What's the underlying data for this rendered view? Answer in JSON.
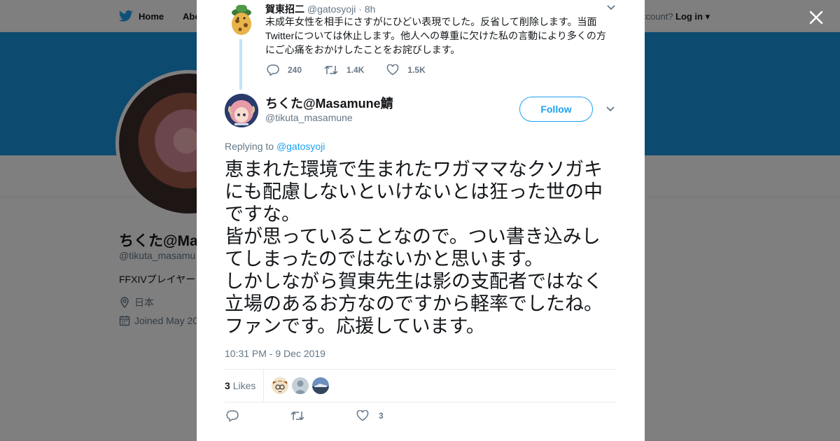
{
  "nav": {
    "home_label": "Home",
    "about_label": "Abo",
    "account_text": "ccount?",
    "login_label": "Log in"
  },
  "profile_bg": {
    "name": "ちくた@Ma",
    "handle": "@tikuta_masamu",
    "bio": "FFXIVプレイヤー",
    "location": "日本",
    "joined": "Joined May 20"
  },
  "parent_tweet": {
    "name": "賀東招二",
    "handle": "@gatosyoji",
    "dot": "·",
    "time": "8h",
    "text": "未成年女性を相手にさすがにひどい表現でした。反省して削除します。当面Twitterについては休止します。他人への尊重に欠けた私の言動により多くの方にご心痛をおかけしたことをお詫びします。",
    "replies": "240",
    "retweets": "1.4K",
    "likes": "1.5K"
  },
  "tweet": {
    "name": "ちくた@Masamune鯖",
    "handle": "@tikuta_masamune",
    "follow_label": "Follow",
    "replying_prefix": "Replying to",
    "replying_handle": "@gatosyoji",
    "text": "恵まれた環境で生まれたワガママなクソガキにも配慮しないといけないとは狂った世の中ですな。\n皆が思っていることなので。つい書き込みしてしまったのではないかと思います。\nしかしながら賀東先生は影の支配者ではなく立場のあるお方なのですから軽率でしたね。\nファンです。応援しています。",
    "timestamp": "10:31 PM - 9 Dec 2019",
    "likes_count": "3",
    "likes_label": "Likes",
    "action_like_count": "3"
  },
  "colors": {
    "brand": "#1da1f2",
    "banner": "#1b95e0",
    "thread_line": "#c4e4f7",
    "muted_text": "#657786"
  },
  "icons": {
    "logo": "twitter-bird-icon",
    "close": "close-icon",
    "reply": "reply-icon",
    "retweet": "retweet-icon",
    "like": "heart-icon",
    "menu": "chevron-down-icon",
    "location": "location-pin-icon",
    "calendar": "calendar-icon"
  }
}
